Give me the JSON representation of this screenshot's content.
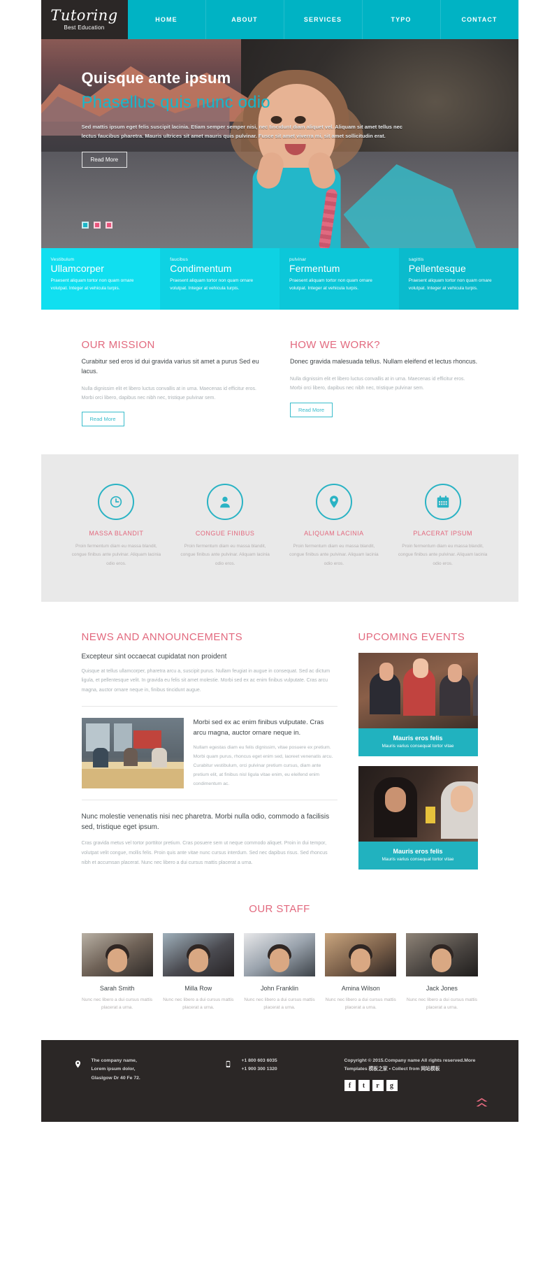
{
  "header": {
    "logo_main": "Tutoring",
    "logo_sub": "Best Education",
    "nav": [
      {
        "label": "HOME"
      },
      {
        "label": "ABOUT"
      },
      {
        "label": "SERVICES"
      },
      {
        "label": "TYPO"
      },
      {
        "label": "CONTACT"
      }
    ]
  },
  "hero": {
    "title1": "Quisque ante ipsum",
    "title2": "Phasellus quis nunc odio",
    "paragraph": "Sed mattis ipsum eget felis suscipit lacinia. Etiam semper semper nisi, nec tincidunt diam aliquet vel. Aliquam sit amet tellus nec lectus faucibus pharetra. Mauris ultrices sit amet mauris quis pulvinar. Fusce sit amet viverra mi, sit amet sollicitudin erat.",
    "button": "Read More",
    "dots": [
      {
        "active": true
      },
      {
        "active": false
      },
      {
        "active": false
      }
    ]
  },
  "features": [
    {
      "sup": "Vestibulum",
      "title": "Ullamcorper",
      "desc": "Praesent aliquam tortor non quam ornare volutpat. Integer at vehicula turpis.",
      "color": "#10dff0"
    },
    {
      "sup": "faucibus",
      "title": "Condimentum",
      "desc": "Praesent aliquam tortor non quam ornare volutpat. Integer at vehicula turpis.",
      "color": "#0ed2e3"
    },
    {
      "sup": "pulvinar",
      "title": "Fermentum",
      "desc": "Praesent aliquam tortor non quam ornare volutpat. Integer at vehicula turpis.",
      "color": "#0cc7d9"
    },
    {
      "sup": "sagittis",
      "title": "Pellentesque",
      "desc": "Praesent aliquam tortor non quam ornare volutpat. Integer at vehicula turpis.",
      "color": "#0abbcd"
    }
  ],
  "mission": [
    {
      "heading": "OUR MISSION",
      "lead": "Curabitur sed eros id dui gravida varius sit amet a purus Sed eu lacus.",
      "body": "Nulla dignissim elit et libero luctus convallis at in urna. Maecenas id efficitur eros. Morbi orci libero, dapibus nec nibh nec, tristique pulvinar sem.",
      "button": "Read More"
    },
    {
      "heading": "HOW WE WORK?",
      "lead": "Donec gravida malesuada tellus. Nullam eleifend et lectus rhoncus.",
      "body": "Nulla dignissim elit et libero luctus convallis at in urna. Maecenas id efficitur eros. Morbi orci libero, dapibus nec nibh nec, tristique pulvinar sem.",
      "button": "Read More"
    }
  ],
  "icons": [
    {
      "icon": "clock-icon",
      "title": "MASSA BLANDIT",
      "desc": "Proin fermentum diam eu massa blandit, congue finibus ante pulvinar. Aliquam lacinia odio eros."
    },
    {
      "icon": "user-icon",
      "title": "CONGUE FINIBUS",
      "desc": "Proin fermentum diam eu massa blandit, congue finibus ante pulvinar. Aliquam lacinia odio eros."
    },
    {
      "icon": "map-pin-icon",
      "title": "ALIQUAM LACINIA",
      "desc": "Proin fermentum diam eu massa blandit, congue finibus ante pulvinar. Aliquam lacinia odio eros."
    },
    {
      "icon": "calendar-icon",
      "title": "PLACERAT IPSUM",
      "desc": "Proin fermentum diam eu massa blandit, congue finibus ante pulvinar. Aliquam lacinia odio eros."
    }
  ],
  "news": {
    "heading": "NEWS AND ANNOUNCEMENTS",
    "subheading": "Excepteur sint occaecat cupidatat non proident",
    "intro": "Quisque at tellus ullamcorper, pharetra arcu a, suscipit purus. Nullam feugiat in augue in consequat. Sed ac dictum ligula, et pellentesque velit. In gravida eu felis sit amet molestie. Morbi sed ex ac enim finibus vulputate. Cras arcu magna, auctor ornare neque in, finibus tincidunt augue.",
    "item": {
      "title": "Morbi sed ex ac enim finibus vulputate. Cras arcu magna, auctor ornare neque in.",
      "body": "Nullam egestas diam eu felis dignissim, vitae posuere ex pretium. Morbi quam purus, rhoncus eget enim sed, laoreet venenatis arcu. Curabitur vestibulum, orci pulvinar pretium cursus, diam ante pretium elit, at finibus nisl ligula vitae enim, eu eleifend enim condimentum ac."
    },
    "item2": {
      "title": "Nunc molestie venenatis nisi nec pharetra. Morbi nulla odio, commodo a facilisis sed, tristique eget ipsum.",
      "body": "Cras gravida metus vel tortor porttitor pretium. Cras posuere sem ut neque commodo aliquet. Proin in dui tempor, volutpat velit congue, mollis felis. Proin quis ante vitae nunc cursus interdum. Sed nec dapibus risus. Sed rhoncus nibh et accumsan placerat. Nunc nec libero a dui cursus mattis placerat a urna."
    }
  },
  "events": {
    "heading": "UPCOMING EVENTS",
    "items": [
      {
        "title": "Mauris eros felis",
        "subtitle": "Mauris varius consequat tortor vitae"
      },
      {
        "title": "Mauris eros felis",
        "subtitle": "Mauris varius consequat tortor vitae"
      }
    ]
  },
  "staff": {
    "heading": "OUR STAFF",
    "members": [
      {
        "name": "Sarah Smith",
        "desc": "Nunc nec libero a dui cursus mattis placerat a urna."
      },
      {
        "name": "Milla Row",
        "desc": "Nunc nec libero a dui cursus mattis placerat a urna."
      },
      {
        "name": "John Franklin",
        "desc": "Nunc nec libero a dui cursus mattis placerat a urna."
      },
      {
        "name": "Amina Wilson",
        "desc": "Nunc nec libero a dui cursus mattis placerat a urna."
      },
      {
        "name": "Jack Jones",
        "desc": "Nunc nec libero a dui cursus mattis placerat a urna."
      }
    ]
  },
  "footer": {
    "address": "The company name,\nLorem ipsum dolor,\nGlaslgow Dr 40 Fe 72.",
    "phone": "+1 800 603 6035\n+1 900 300 1320",
    "copyright": "Copyright © 2015.Company name All rights reserved.More Templates 模板之家 • Collect from 网站模板",
    "socials": [
      {
        "glyph": "f",
        "name": "facebook-icon"
      },
      {
        "glyph": "t",
        "name": "twitter-icon"
      },
      {
        "glyph": "r",
        "name": "rss-icon"
      },
      {
        "glyph": "g",
        "name": "google-plus-icon"
      }
    ]
  },
  "colors": {
    "accent_teal": "#00b3c4",
    "accent_pink": "#e2697e",
    "dark": "#2b2726"
  }
}
